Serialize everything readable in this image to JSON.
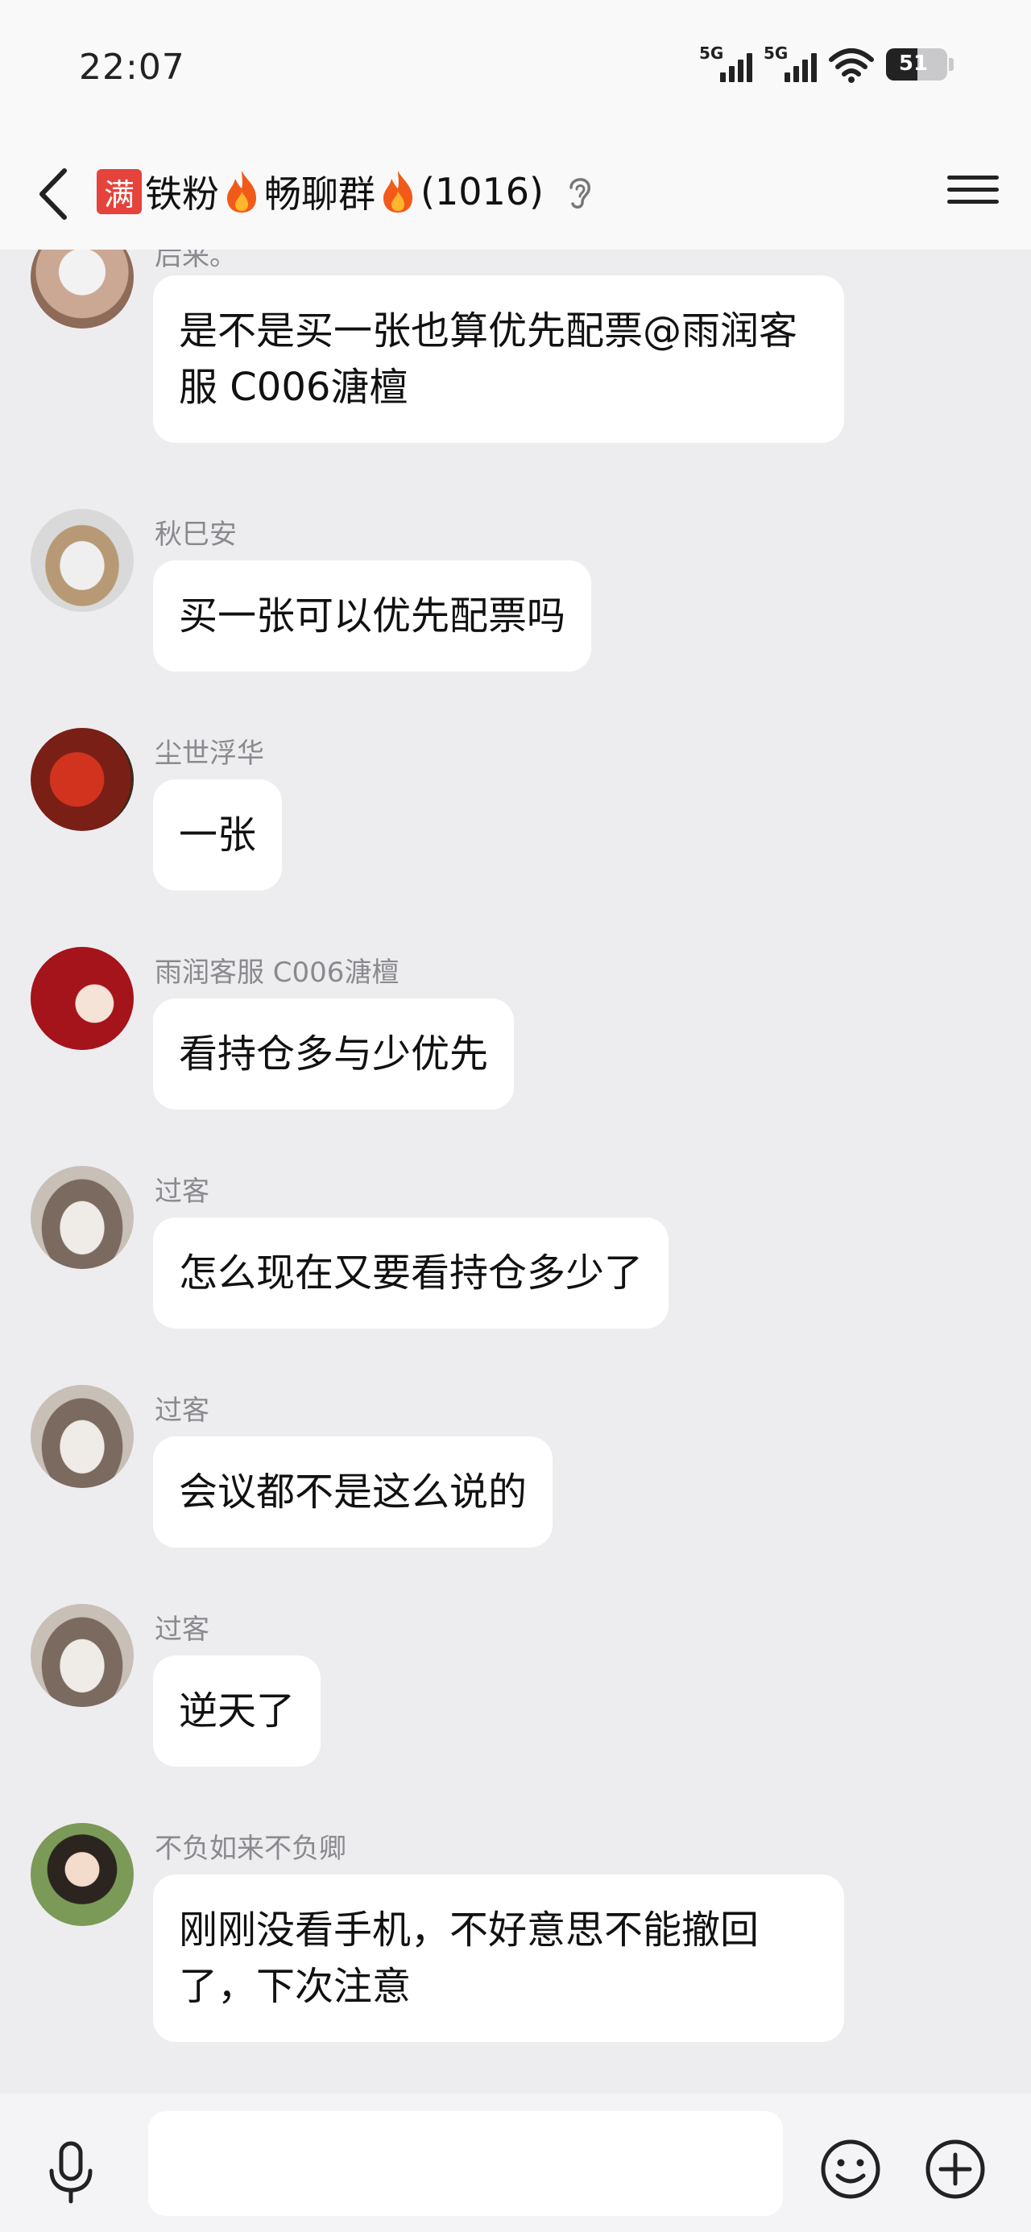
{
  "status_bar": {
    "time": "22:07",
    "signal_1_label": "5G",
    "signal_2_label": "5G",
    "battery_level": "51"
  },
  "header": {
    "badge": "满",
    "name_part1": "铁粉",
    "name_part2": "畅聊群",
    "member_count": "(1016)",
    "icons": [
      "back-arrow-icon",
      "fire-icon",
      "ear-icon",
      "menu-icon"
    ]
  },
  "messages": [
    {
      "sender": "后来。",
      "text": "是不是买一张也算优先配票@雨润客服 C006溏檀"
    },
    {
      "sender": "秋巳安",
      "text": "买一张可以优先配票吗"
    },
    {
      "sender": "尘世浮华",
      "text": "一张"
    },
    {
      "sender": "雨润客服 C006溏檀",
      "text": "看持仓多与少优先"
    },
    {
      "sender": "过客",
      "text": "怎么现在又要看持仓多少了"
    },
    {
      "sender": "过客",
      "text": "会议都不是这么说的"
    },
    {
      "sender": "过客",
      "text": "逆天了"
    },
    {
      "sender": "不负如来不负卿",
      "text": "刚刚没看手机，不好意思不能撤回了，下次注意"
    }
  ],
  "input_bar": {
    "text_value": "",
    "icons": [
      "microphone-icon",
      "emoji-icon",
      "plus-icon"
    ]
  },
  "colors": {
    "background": "#ededf0",
    "bubble": "#ffffff",
    "badge_red": "#e5433b",
    "sender_gray": "#8a8a8e"
  }
}
